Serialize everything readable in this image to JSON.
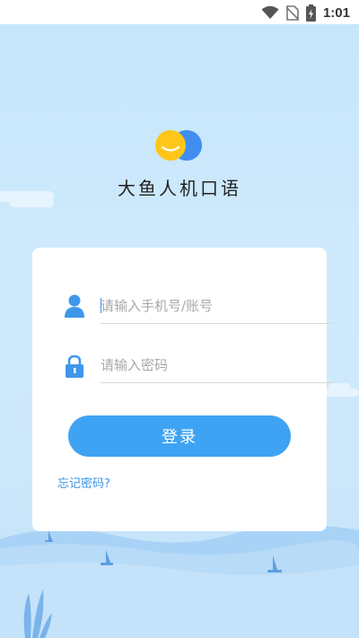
{
  "status_bar": {
    "time": "1:01",
    "icons": [
      "wifi-icon",
      "no-sim-icon",
      "battery-charging-icon"
    ]
  },
  "app": {
    "name": "大鱼人机口语",
    "logo_icon": "smiley-logo-icon"
  },
  "login_form": {
    "account_placeholder": "请输入手机号/账号",
    "account_value": "",
    "password_placeholder": "请输入密码",
    "password_value": "",
    "account_icon": "user-icon",
    "password_icon": "lock-icon",
    "login_label": "登录",
    "forgot_label": "忘记密码?"
  },
  "colors": {
    "accent": "#3fa3f3",
    "link": "#3b95e6",
    "background": "#c6e6fb",
    "logo_yellow": "#ffc61a",
    "logo_blue": "#3f8ef0"
  }
}
